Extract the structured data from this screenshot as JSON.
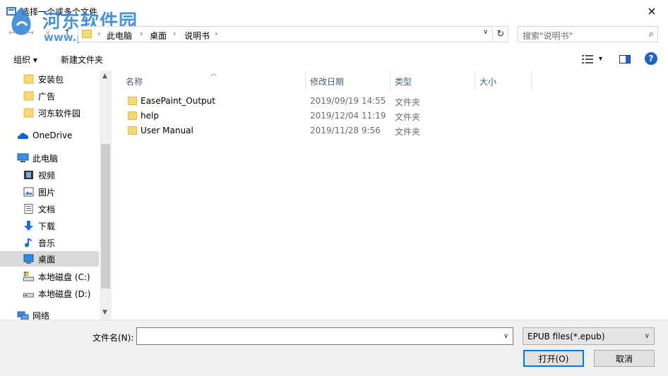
{
  "window": {
    "title": "选择一个或多个文件",
    "watermark_cn": "河东软件园",
    "watermark_url": "www.pc0359.cn"
  },
  "icons": {
    "close": "×",
    "back": "←",
    "forward": "→",
    "up": "↑",
    "dropdown": "∨",
    "refresh": "↻",
    "search": "⌕",
    "chevron_right": "›",
    "help": "?"
  },
  "address": {
    "crumbs": [
      "此电脑",
      "桌面",
      "说明书"
    ]
  },
  "search": {
    "placeholder": "搜索\"说明书\""
  },
  "toolbar": {
    "organize": "组织 ▾",
    "new_folder": "新建文件夹",
    "view_menu": "▾"
  },
  "nav": {
    "items": [
      {
        "label": "安装包",
        "icon": "folder-icon"
      },
      {
        "label": "广告",
        "icon": "folder-icon"
      },
      {
        "label": "河东软件园",
        "icon": "folder-icon"
      },
      {
        "label": "OneDrive",
        "icon": "onedrive-icon"
      },
      {
        "label": "此电脑",
        "icon": "this-pc-icon"
      },
      {
        "label": "视频",
        "icon": "videos-icon"
      },
      {
        "label": "图片",
        "icon": "pictures-icon"
      },
      {
        "label": "文档",
        "icon": "documents-icon"
      },
      {
        "label": "下载",
        "icon": "downloads-icon"
      },
      {
        "label": "音乐",
        "icon": "music-icon"
      },
      {
        "label": "桌面",
        "icon": "desktop-icon",
        "selected": true
      },
      {
        "label": "本地磁盘 (C:)",
        "icon": "drive-c-icon"
      },
      {
        "label": "本地磁盘 (D:)",
        "icon": "drive-d-icon"
      },
      {
        "label": "网络",
        "icon": "network-icon"
      }
    ]
  },
  "list": {
    "columns": [
      "名称",
      "修改日期",
      "类型",
      "大小"
    ],
    "rows": [
      {
        "name": "EasePaint_Output",
        "date": "2019/09/19 14:55",
        "type": "文件夹",
        "size": ""
      },
      {
        "name": "help",
        "date": "2019/12/04 11:19",
        "type": "文件夹",
        "size": ""
      },
      {
        "name": "User Manual",
        "date": "2019/11/28 9:56",
        "type": "文件夹",
        "size": ""
      }
    ]
  },
  "footer": {
    "filename_label": "文件名(N):",
    "filename_value": "",
    "filetype": "EPUB files(*.epub)",
    "open_label": "打开(O)",
    "cancel_label": "取消"
  },
  "colors": {
    "accent": "#0078d7",
    "folder": "#f8d775",
    "selected_bg": "#d9d9d9",
    "header_text": "#4c607a",
    "help_blue": "#1d64c8"
  }
}
